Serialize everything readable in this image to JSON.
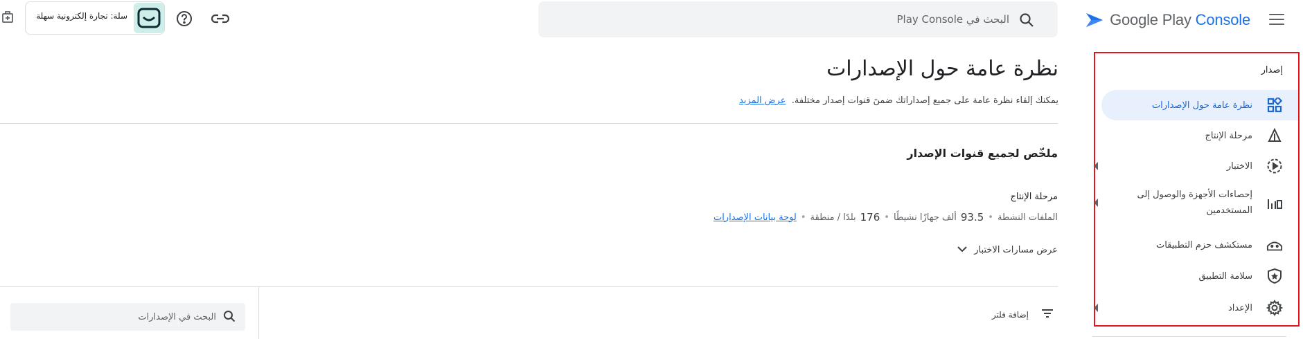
{
  "brand": {
    "logo_prefix": "Google Play ",
    "logo_accent": "Console"
  },
  "colors": {
    "accent": "#1a73e8",
    "highlight_border": "#e4121b",
    "active_bg": "#e8f0fe"
  },
  "topbar": {
    "search_placeholder": "البحث في Play Console",
    "app_name": "سلة: تجارة إلكترونية سهلة"
  },
  "nav": {
    "section_label": "إصدار",
    "items": [
      {
        "label": "نظرة عامة حول الإصدارات",
        "icon": "dashboard-icon",
        "active": true
      },
      {
        "label": "مرحلة الإنتاج",
        "icon": "production-icon"
      },
      {
        "label": "الاختبار",
        "icon": "testing-icon",
        "expandable": true
      },
      {
        "label": "إحصاءات الأجهزة والوصول إلى المستخدمين",
        "icon": "bar-chart-icon",
        "expandable": true
      },
      {
        "label": "مستكشف حزم التطبيقات",
        "icon": "bundle-icon"
      },
      {
        "label": "سلامة التطبيق",
        "icon": "shield-icon"
      },
      {
        "label": "الإعداد",
        "icon": "gear-icon",
        "expandable": true
      }
    ]
  },
  "main": {
    "title": "نظرة عامة حول الإصدارات",
    "description": "يمكنك إلقاء نظرة عامة على جميع إصداراتك ضمنَ قنوات إصدار مختلفة.",
    "learn_more": "عرض المزيد",
    "summary_title": "ملخّص لجميع قنوات الإصدار",
    "stage_label": "مرحلة الإنتاج",
    "stats": {
      "active_files": "الملفات النشطة",
      "devices_value": "93.5",
      "devices_label": "ألف جهازًا نشيطًا",
      "countries_value": "176",
      "countries_label": "بلدًا / منطقة",
      "dashboard_link": "لوحة بيانات الإصدارات"
    },
    "show_tracks": "عرض مسارات الاختبار",
    "add_filter": "إضافة فلتر",
    "releases_search_placeholder": "البحث في الإصدارات"
  }
}
